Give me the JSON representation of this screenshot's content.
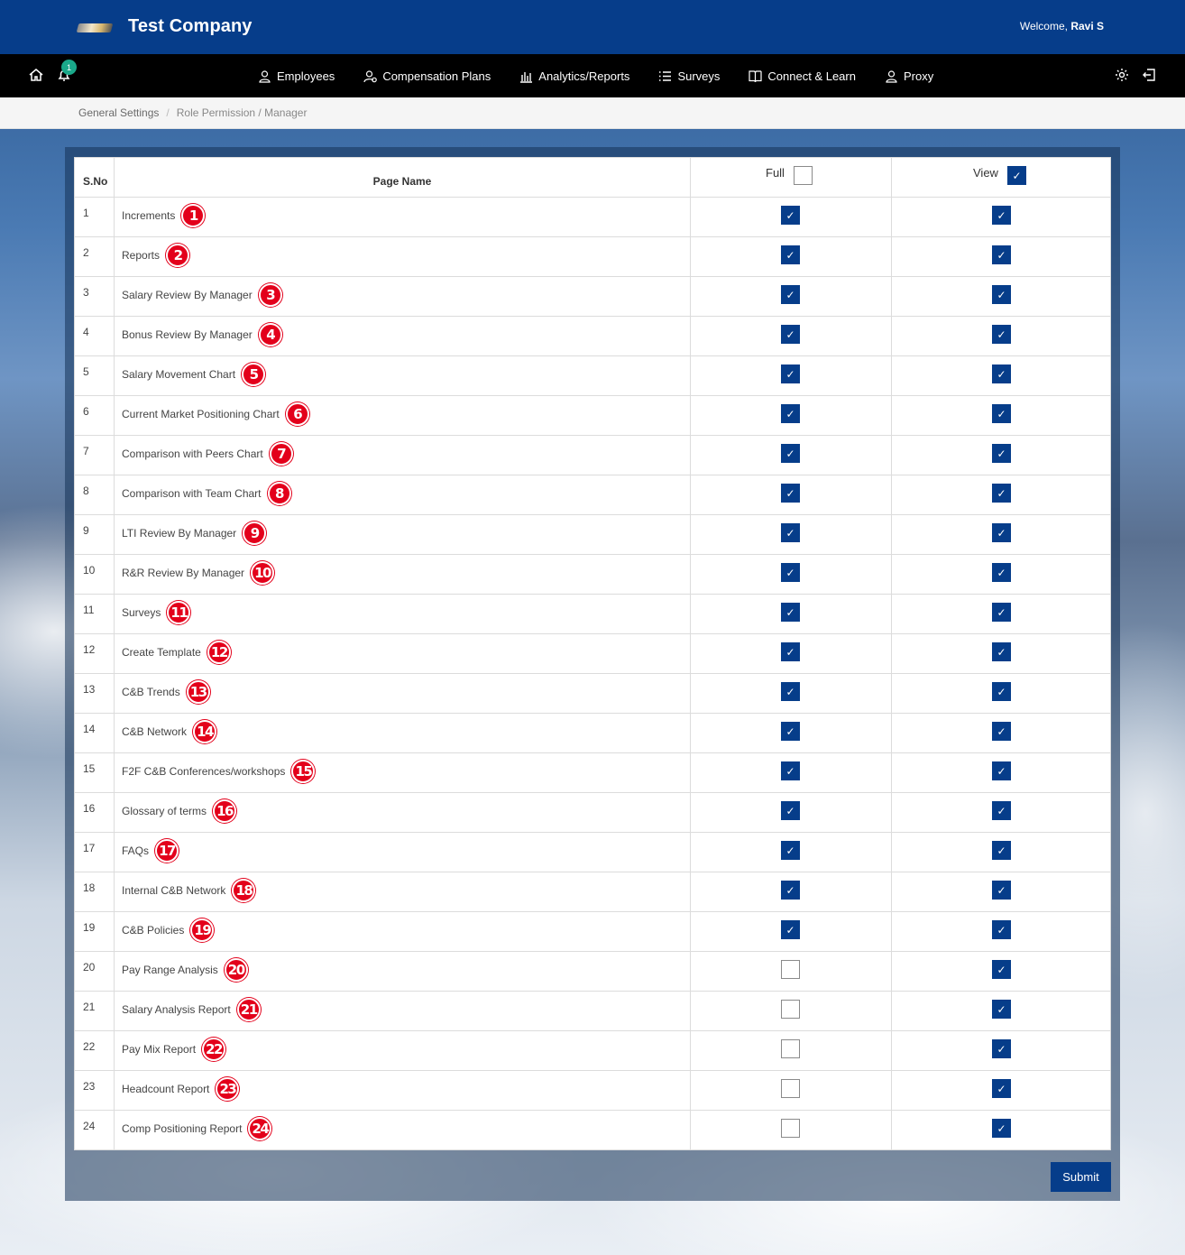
{
  "header": {
    "company": "Test Company",
    "welcome_prefix": "Welcome,",
    "user": "Ravi S"
  },
  "nav": {
    "notification_count": "1",
    "items": [
      {
        "label": "Employees",
        "icon": "user-icon"
      },
      {
        "label": "Compensation Plans",
        "icon": "user-money-icon"
      },
      {
        "label": "Analytics/Reports",
        "icon": "bar-chart-icon"
      },
      {
        "label": "Surveys",
        "icon": "list-icon"
      },
      {
        "label": "Connect & Learn",
        "icon": "book-icon"
      },
      {
        "label": "Proxy",
        "icon": "user-icon"
      }
    ]
  },
  "breadcrumb": {
    "parent": "General Settings",
    "separator": "/",
    "current": "Role Permission / Manager"
  },
  "table": {
    "headers": {
      "sno": "S.No",
      "page_name": "Page Name",
      "full": "Full",
      "view": "View"
    },
    "header_checks": {
      "full": false,
      "view": true
    },
    "rows": [
      {
        "sno": "1",
        "name": "Increments",
        "marker": "1",
        "full": true,
        "view": true
      },
      {
        "sno": "2",
        "name": "Reports",
        "marker": "2",
        "full": true,
        "view": true
      },
      {
        "sno": "3",
        "name": "Salary Review By Manager",
        "marker": "3",
        "full": true,
        "view": true
      },
      {
        "sno": "4",
        "name": "Bonus Review By Manager",
        "marker": "4",
        "full": true,
        "view": true
      },
      {
        "sno": "5",
        "name": "Salary Movement Chart",
        "marker": "5",
        "full": true,
        "view": true
      },
      {
        "sno": "6",
        "name": "Current Market Positioning Chart",
        "marker": "6",
        "full": true,
        "view": true
      },
      {
        "sno": "7",
        "name": "Comparison with Peers Chart",
        "marker": "7",
        "full": true,
        "view": true
      },
      {
        "sno": "8",
        "name": "Comparison with Team Chart",
        "marker": "8",
        "full": true,
        "view": true
      },
      {
        "sno": "9",
        "name": "LTI Review By Manager",
        "marker": "9",
        "full": true,
        "view": true
      },
      {
        "sno": "10",
        "name": "R&R Review By Manager",
        "marker": "10",
        "full": true,
        "view": true
      },
      {
        "sno": "11",
        "name": "Surveys",
        "marker": "11",
        "full": true,
        "view": true
      },
      {
        "sno": "12",
        "name": "Create Template",
        "marker": "12",
        "full": true,
        "view": true
      },
      {
        "sno": "13",
        "name": "C&B Trends",
        "marker": "13",
        "full": true,
        "view": true
      },
      {
        "sno": "14",
        "name": "C&B Network",
        "marker": "14",
        "full": true,
        "view": true
      },
      {
        "sno": "15",
        "name": "F2F C&B Conferences/workshops",
        "marker": "15",
        "full": true,
        "view": true
      },
      {
        "sno": "16",
        "name": "Glossary of terms",
        "marker": "16",
        "full": true,
        "view": true
      },
      {
        "sno": "17",
        "name": "FAQs",
        "marker": "17",
        "full": true,
        "view": true
      },
      {
        "sno": "18",
        "name": "Internal C&B Network",
        "marker": "18",
        "full": true,
        "view": true
      },
      {
        "sno": "19",
        "name": "C&B Policies",
        "marker": "19",
        "full": true,
        "view": true
      },
      {
        "sno": "20",
        "name": "Pay Range Analysis",
        "marker": "20",
        "full": false,
        "view": true
      },
      {
        "sno": "21",
        "name": "Salary Analysis Report",
        "marker": "21",
        "full": false,
        "view": true
      },
      {
        "sno": "22",
        "name": "Pay Mix Report",
        "marker": "22",
        "full": false,
        "view": true
      },
      {
        "sno": "23",
        "name": "Headcount Report",
        "marker": "23",
        "full": false,
        "view": true
      },
      {
        "sno": "24",
        "name": "Comp Positioning Report",
        "marker": "24",
        "full": false,
        "view": true
      }
    ]
  },
  "actions": {
    "submit": "Submit"
  },
  "colors": {
    "brand": "#063d8a",
    "nav_bg": "#000000",
    "marker": "#e3001b",
    "badge": "#1aa98a"
  },
  "check_glyph": "✓"
}
